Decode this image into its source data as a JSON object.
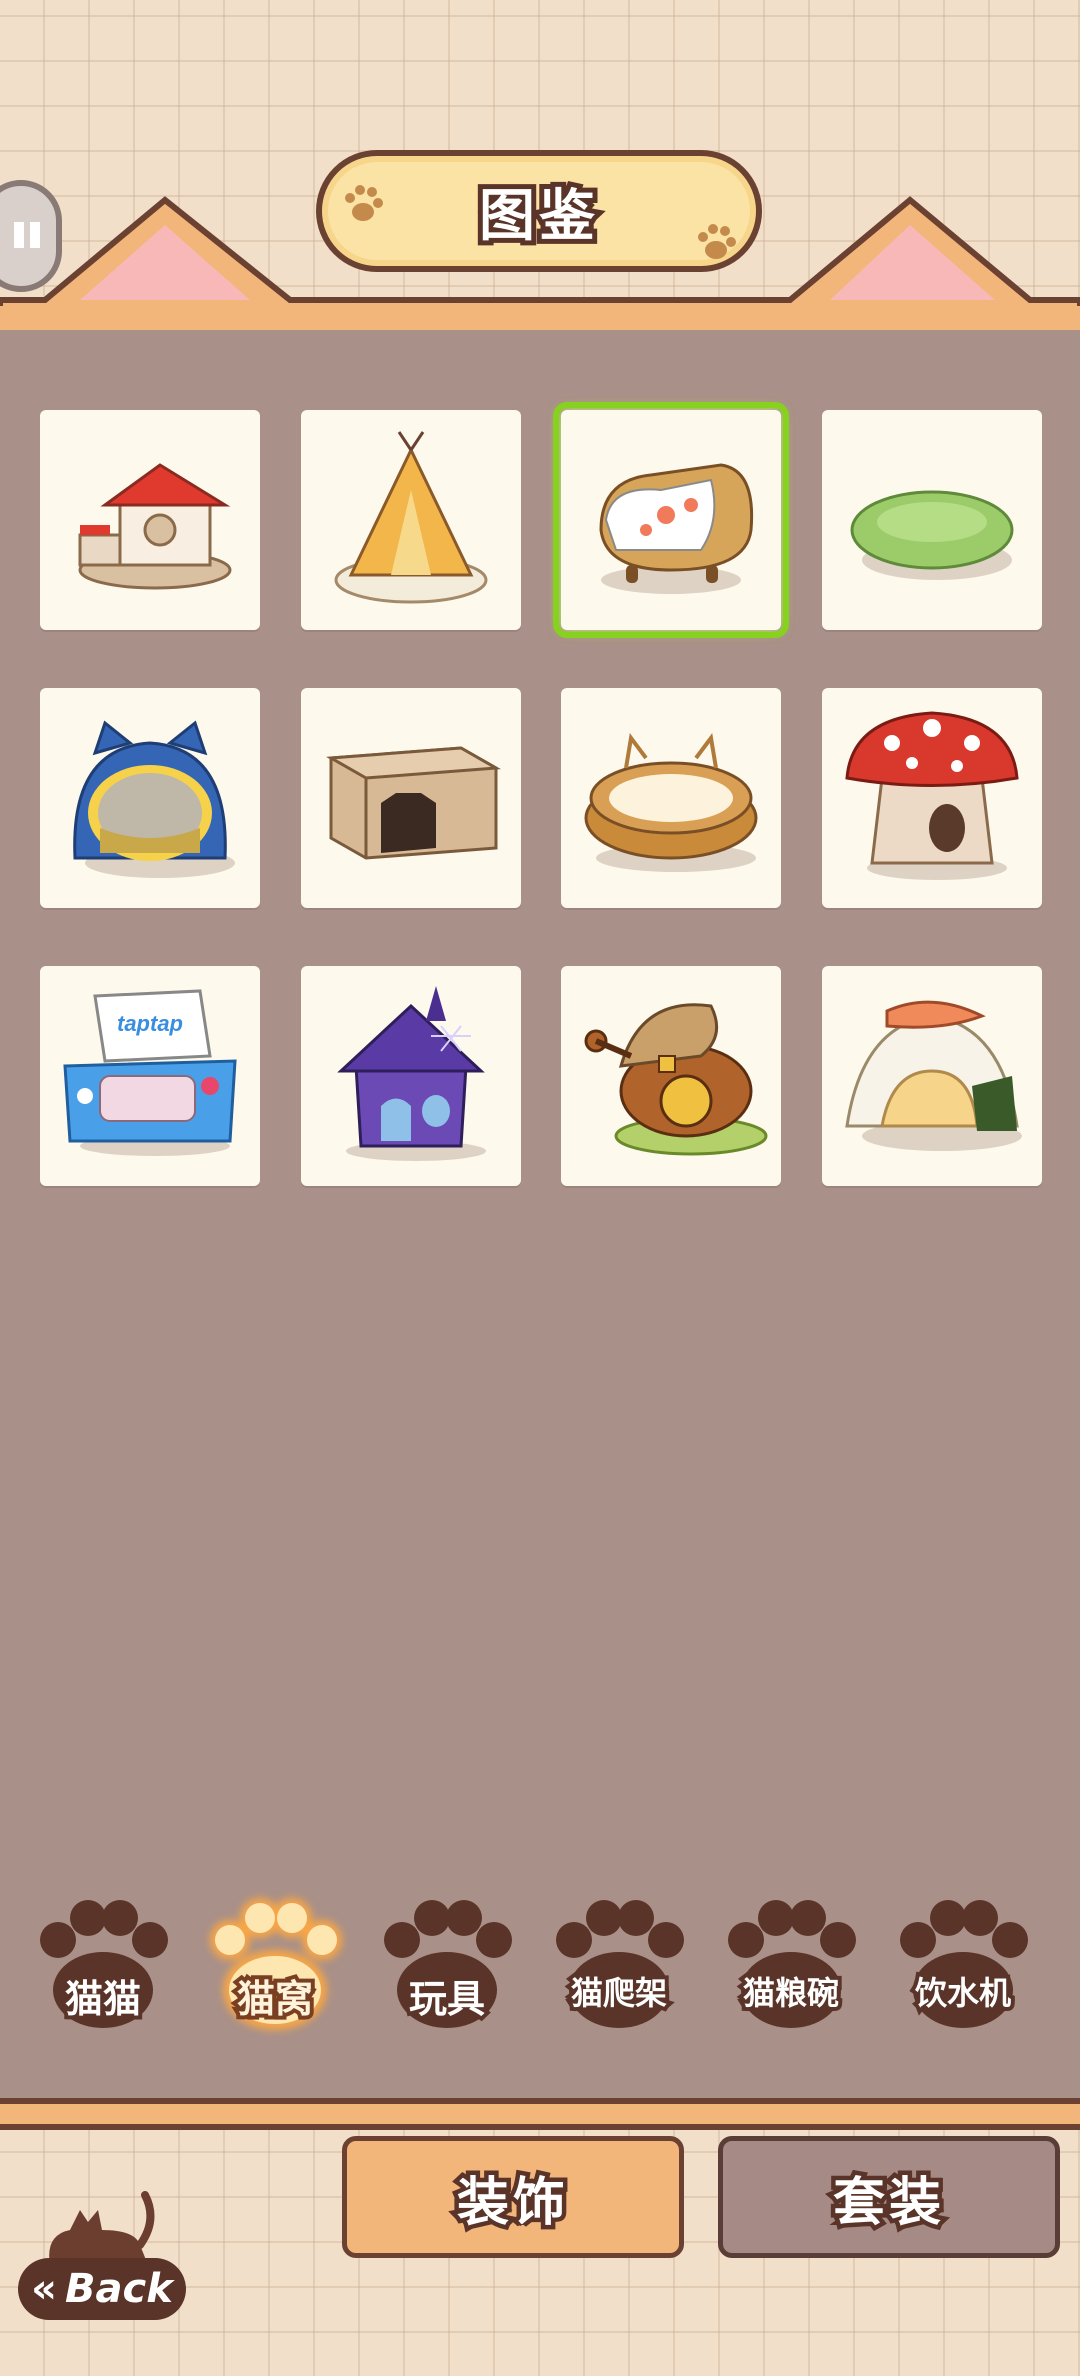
{
  "header": {
    "title": "图鉴"
  },
  "grid": {
    "selected_index": 2,
    "items": [
      {
        "icon": "red-roof-house-icon"
      },
      {
        "icon": "tipi-tent-icon"
      },
      {
        "icon": "wicker-chair-bed-icon"
      },
      {
        "icon": "green-round-bed-icon"
      },
      {
        "icon": "blue-cat-dome-icon"
      },
      {
        "icon": "cardboard-box-icon"
      },
      {
        "icon": "woven-basket-bed-icon"
      },
      {
        "icon": "mushroom-house-icon"
      },
      {
        "icon": "taptap-console-bed-icon",
        "label": "taptap"
      },
      {
        "icon": "haunted-house-icon"
      },
      {
        "icon": "acorn-house-icon"
      },
      {
        "icon": "onigiri-sushi-bed-icon"
      }
    ]
  },
  "tabs": [
    {
      "label": "猫猫",
      "active": false
    },
    {
      "label": "猫窝",
      "active": true
    },
    {
      "label": "玩具",
      "active": false
    },
    {
      "label": "猫爬架",
      "active": false
    },
    {
      "label": "猫粮碗",
      "active": false
    },
    {
      "label": "饮水机",
      "active": false
    }
  ],
  "footer": {
    "decor_label": "装饰",
    "set_label": "套装",
    "back_label": "Back"
  },
  "colors": {
    "accent_selected": "#86d21f",
    "panel": "#a99088",
    "paw": "#5a3428"
  }
}
